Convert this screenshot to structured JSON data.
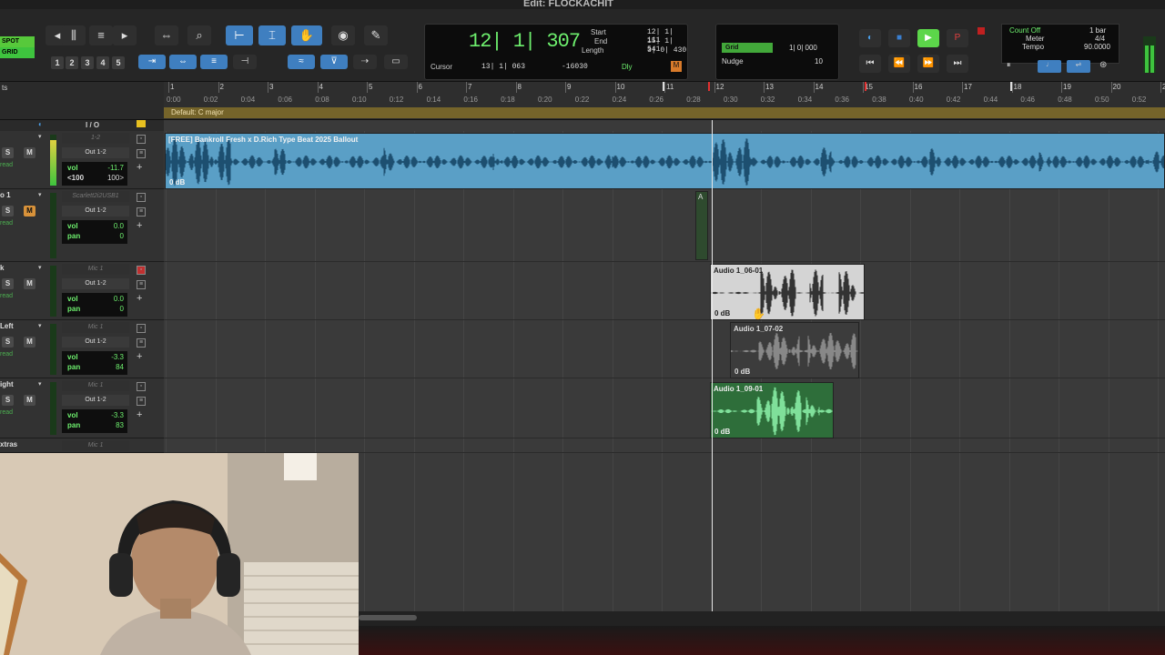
{
  "window": {
    "title": "Edit: FLOCKACHIT"
  },
  "toolbar": {
    "modes": [
      "SPOT",
      "GRID"
    ],
    "zoom_presets": [
      "1",
      "2",
      "3",
      "4",
      "5"
    ]
  },
  "counter": {
    "main": "12| 1| 307",
    "start_label": "Start",
    "start": "12| 1| 111",
    "end_label": "End",
    "end": "15| 1| 541",
    "length_label": "Length",
    "length": "3| 0| 430",
    "cursor_label": "Cursor",
    "cursor": "13| 1| 063",
    "sample": "-16030",
    "dly": "Dly"
  },
  "grid": {
    "grid_label": "Grid",
    "grid_value": "1| 0| 000",
    "nudge_label": "Nudge",
    "nudge_value": "10"
  },
  "countoff": {
    "count_off": "Count Off",
    "bar": "1 bar",
    "meter": "Meter",
    "meter_value": "4/4",
    "tempo": "Tempo",
    "tempo_value": "90.0000"
  },
  "ruler": {
    "key_signature": "Default: C major",
    "bars": [
      "1",
      "2",
      "3",
      "4",
      "5",
      "6",
      "7",
      "8",
      "9",
      "10",
      "11",
      "12",
      "13",
      "14",
      "15",
      "16",
      "17",
      "18",
      "19",
      "20",
      "21"
    ],
    "times": [
      "0:00",
      "0:02",
      "0:04",
      "0:06",
      "0:08",
      "0:10",
      "0:12",
      "0:14",
      "0:16",
      "0:18",
      "0:20",
      "0:22",
      "0:24",
      "0:26",
      "0:28",
      "0:30",
      "0:32",
      "0:34",
      "0:36",
      "0:38",
      "0:40",
      "0:42",
      "0:44",
      "0:46",
      "0:48",
      "0:50",
      "0:52"
    ]
  },
  "io_header": "I / O",
  "tracks": [
    {
      "name": "",
      "input": "1-2",
      "output": "Out 1-2",
      "vol_label": "vol",
      "vol": "-11.7",
      "pan_left": "<100",
      "pan_right": "100>",
      "auto": "read",
      "meter_level": 0.9
    },
    {
      "name": "o 1",
      "input": "Scarlett2i2USB1",
      "output": "Out 1-2",
      "vol_label": "vol",
      "vol": "0.0",
      "pan_label": "pan",
      "pan": "0",
      "auto": "read",
      "mode": "rm",
      "meter_level": 0
    },
    {
      "name": "k",
      "input": "Mic 1",
      "output": "Out 1-2",
      "vol_label": "vol",
      "vol": "0.0",
      "pan_label": "pan",
      "pan": "0",
      "auto": "read",
      "meter_level": 0
    },
    {
      "name": "Left",
      "input": "Mic 1",
      "output": "Out 1-2",
      "vol_label": "vol",
      "vol": "-3.3",
      "pan_label": "pan",
      "pan": "84",
      "auto": "read",
      "meter_level": 0
    },
    {
      "name": "ight",
      "input": "Mic 1",
      "output": "Out 1-2",
      "vol_label": "vol",
      "vol": "-3.3",
      "pan_label": "pan",
      "pan": "83",
      "auto": "read",
      "meter_level": 0
    },
    {
      "name": "xtras",
      "input": "Mic 1"
    }
  ],
  "clips": {
    "beat": {
      "name": "[FREE] Bankroll Fresh x D.Rich Type Beat 2025 Ballout",
      "gain": "0 dB"
    },
    "c1": {
      "name": "Audio 1_06-01",
      "gain": "0 dB"
    },
    "c2": {
      "name": "Audio 1_07-02",
      "gain": "0 dB"
    },
    "c3": {
      "name": "Audio 1_09-01",
      "gain": "0 dB"
    },
    "marker": "A"
  },
  "buttons": {
    "solo": "S",
    "mute": "M"
  },
  "colors": {
    "beat_clip": "#5a9fc6",
    "green_clip": "#2e6e3a",
    "selected_clip": "#d4d4d4",
    "counter_text": "#6ef06e"
  }
}
